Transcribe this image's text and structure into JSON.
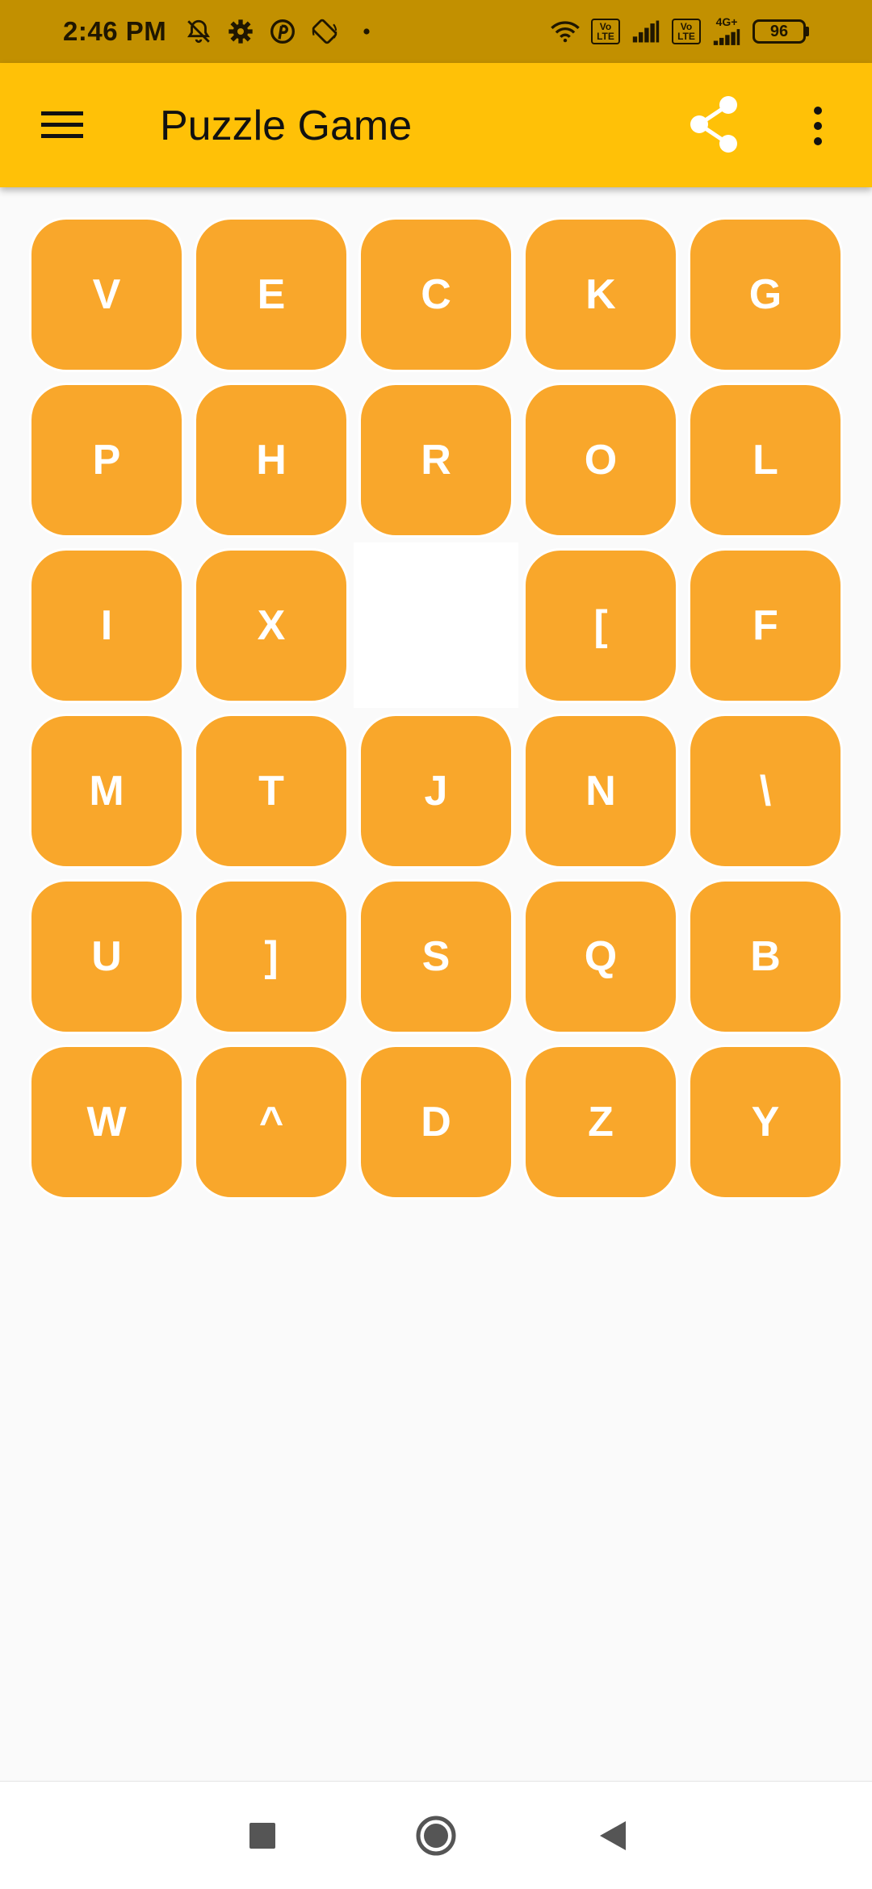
{
  "status_bar": {
    "time": "2:46 PM",
    "volte_1": "Vo\nLTE",
    "volte_2": "Vo\nLTE",
    "network_type": "4G+",
    "battery": "96",
    "icons": [
      "bell-off-icon",
      "gear-icon",
      "pinterest-icon",
      "screen-rotate-icon",
      "dot-icon",
      "wifi-icon",
      "signal-icon",
      "signal-icon",
      "battery-icon"
    ]
  },
  "app_bar": {
    "title": "Puzzle Game",
    "icons": [
      "hamburger-menu-icon",
      "share-icon",
      "overflow-menu-icon"
    ]
  },
  "board": {
    "columns": 5,
    "rows": 6,
    "tiles": [
      [
        "V",
        "E",
        "C",
        "K",
        "G"
      ],
      [
        "P",
        "H",
        "R",
        "O",
        "L"
      ],
      [
        "I",
        "X",
        "",
        "[",
        "F"
      ],
      [
        "M",
        "T",
        "J",
        "N",
        "\\"
      ],
      [
        "U",
        "]",
        "S",
        "Q",
        "B"
      ],
      [
        "W",
        "^",
        "D",
        "Z",
        "Y"
      ]
    ],
    "colors": {
      "tile": "#f9a72b",
      "tile_text": "#ffffff",
      "empty": "#ffffff",
      "app_bar": "#ffc107",
      "status_bar": "#c29000",
      "background": "#fafafa"
    }
  },
  "nav_bar": {
    "icons": [
      "recents-square-icon",
      "home-circle-icon",
      "back-triangle-icon"
    ]
  }
}
